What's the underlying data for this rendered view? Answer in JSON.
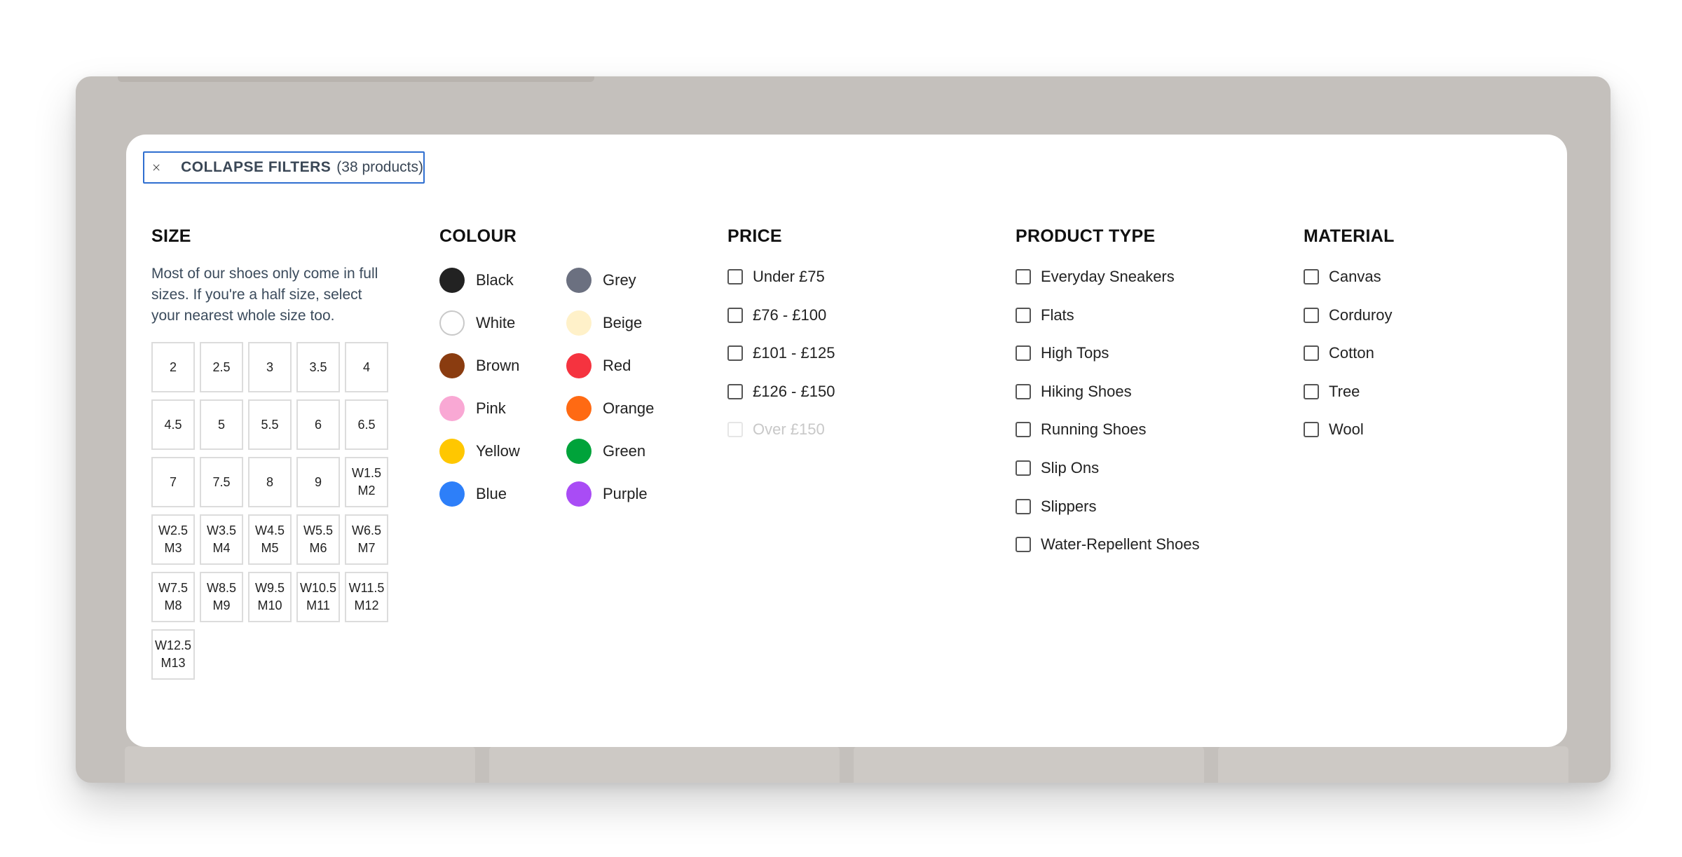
{
  "collapse": {
    "label": "COLLAPSE FILTERS",
    "count": "(38 products)"
  },
  "size": {
    "title": "SIZE",
    "note": "Most of our shoes only come in full sizes. If you're a half size, select your nearest whole size too.",
    "options": [
      "2",
      "2.5",
      "3",
      "3.5",
      "4",
      "4.5",
      "5",
      "5.5",
      "6",
      "6.5",
      "7",
      "7.5",
      "8",
      "9",
      "W1.5\nM2",
      "W2.5\nM3",
      "W3.5\nM4",
      "W4.5\nM5",
      "W5.5\nM6",
      "W6.5\nM7",
      "W7.5\nM8",
      "W8.5\nM9",
      "W9.5\nM10",
      "W10.5\nM11",
      "W11.5\nM12",
      "W12.5\nM13"
    ]
  },
  "colour": {
    "title": "COLOUR",
    "options": [
      {
        "label": "Black",
        "color": "#222222"
      },
      {
        "label": "Grey",
        "color": "#6b7080"
      },
      {
        "label": "White",
        "color": "#ffffff"
      },
      {
        "label": "Beige",
        "color": "#fff1c9"
      },
      {
        "label": "Brown",
        "color": "#8a3c10"
      },
      {
        "label": "Red",
        "color": "#f5333f"
      },
      {
        "label": "Pink",
        "color": "#f9a8d4"
      },
      {
        "label": "Orange",
        "color": "#ff6a13"
      },
      {
        "label": "Yellow",
        "color": "#ffc700"
      },
      {
        "label": "Green",
        "color": "#00a33a"
      },
      {
        "label": "Blue",
        "color": "#2d7ff9"
      },
      {
        "label": "Purple",
        "color": "#a94cf5"
      }
    ]
  },
  "price": {
    "title": "PRICE",
    "options": [
      {
        "label": "Under £75",
        "disabled": false
      },
      {
        "label": "£76 - £100",
        "disabled": false
      },
      {
        "label": "£101 - £125",
        "disabled": false
      },
      {
        "label": "£126 - £150",
        "disabled": false
      },
      {
        "label": "Over £150",
        "disabled": true
      }
    ]
  },
  "product_type": {
    "title": "PRODUCT TYPE",
    "options": [
      "Everyday Sneakers",
      "Flats",
      "High Tops",
      "Hiking Shoes",
      "Running Shoes",
      "Slip Ons",
      "Slippers",
      "Water-Repellent Shoes"
    ]
  },
  "material": {
    "title": "MATERIAL",
    "options": [
      "Canvas",
      "Corduroy",
      "Cotton",
      "Tree",
      "Wool"
    ]
  }
}
